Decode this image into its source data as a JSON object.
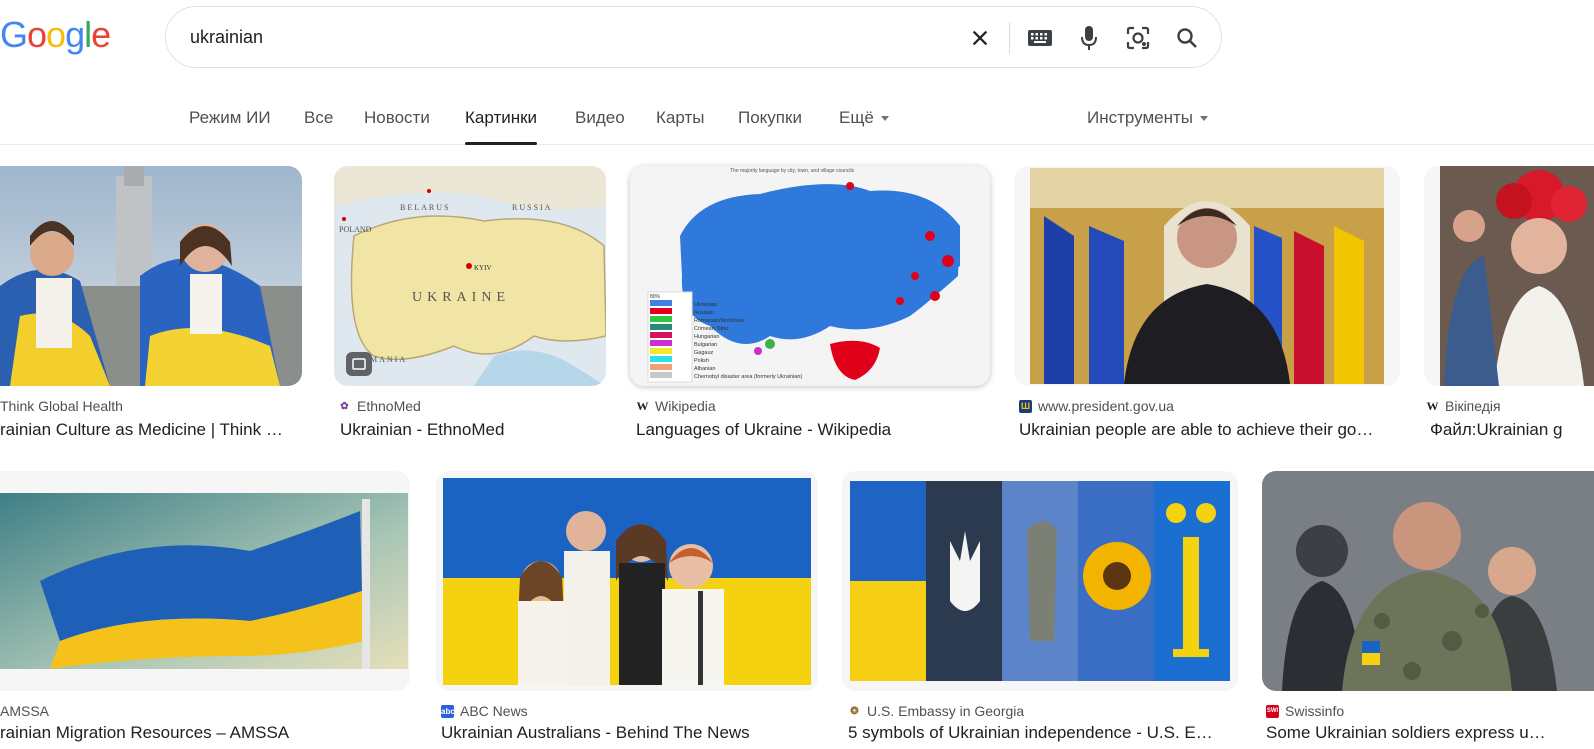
{
  "logo": {
    "letters": [
      "G",
      "o",
      "o",
      "g",
      "l",
      "e"
    ],
    "colors": [
      "#4285F4",
      "#EA4335",
      "#FBBC05",
      "#4285F4",
      "#34A853",
      "#EA4335"
    ]
  },
  "search": {
    "query": "ukrainian"
  },
  "tabs": [
    {
      "label": "Режим ИИ",
      "active": false
    },
    {
      "label": "Все",
      "active": false
    },
    {
      "label": "Новости",
      "active": false
    },
    {
      "label": "Картинки",
      "active": true
    },
    {
      "label": "Видео",
      "active": false
    },
    {
      "label": "Карты",
      "active": false
    },
    {
      "label": "Покупки",
      "active": false
    },
    {
      "label": "Ещё",
      "active": false
    }
  ],
  "tools_label": "Инструменты",
  "results": [
    {
      "source": "Think Global Health",
      "title": "rainian Culture as Medicine | Think …"
    },
    {
      "source": "EthnoMed",
      "title": "Ukrainian - EthnoMed",
      "map_labels": [
        "BELARUS",
        "RUSSIA",
        "POLAND",
        "KYIV",
        "UKRAINE",
        "MANIA"
      ]
    },
    {
      "source": "Wikipedia",
      "title": "Languages of Ukraine - Wikipedia",
      "map_header": "The majority language by city, town, and village councils",
      "legend": [
        "Ukrainian",
        "Russian",
        "Romanian/Moldovan",
        "Crimean Tatar",
        "Hungarian",
        "Bulgarian",
        "Gagauz",
        "Polish",
        "Albanian",
        "Chernobyl disaster area (formerly Ukrainian)"
      ],
      "legend_top": "80%"
    },
    {
      "source": "www.president.gov.ua",
      "title": "Ukrainian people are able to achieve their go…"
    },
    {
      "source": "Вікіпедія",
      "title": "Файл:Ukrainian g"
    },
    {
      "source": "AMSSA",
      "title": "rainian Migration Resources – AMSSA"
    },
    {
      "source": "ABC News",
      "title": "Ukrainian Australians - Behind The News"
    },
    {
      "source": "U.S. Embassy in Georgia",
      "title": "5 symbols of Ukrainian independence - U.S. E…"
    },
    {
      "source": "Swissinfo",
      "title": "Some Ukrainian soldiers express un…"
    }
  ]
}
